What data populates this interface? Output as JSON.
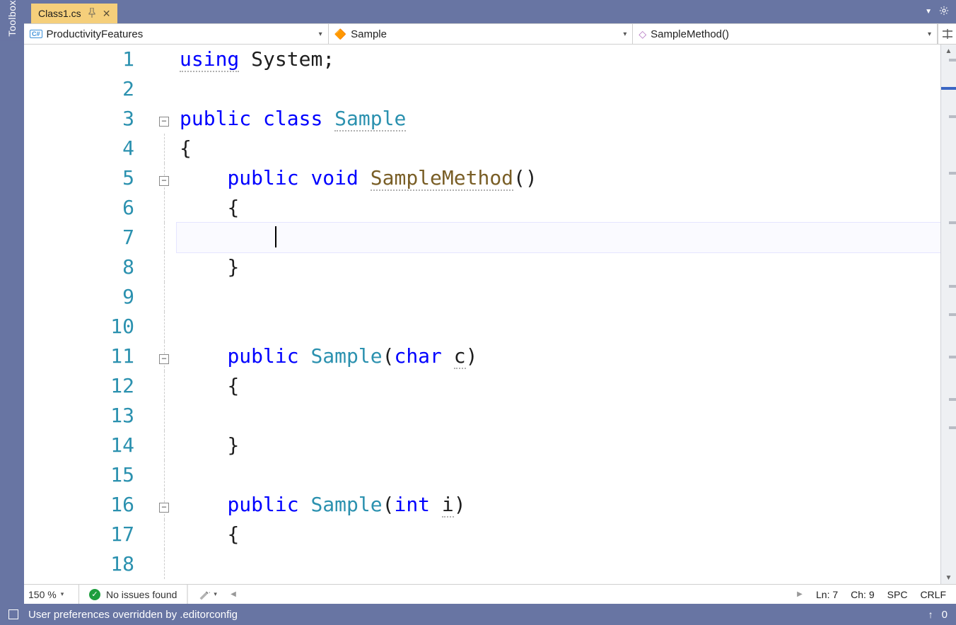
{
  "toolbox_label": "Toolbox",
  "tab": {
    "filename": "Class1.cs"
  },
  "nav": {
    "namespace": "ProductivityFeatures",
    "class": "Sample",
    "member": "SampleMethod()"
  },
  "code": {
    "line_numbers": [
      "1",
      "2",
      "3",
      "4",
      "5",
      "6",
      "7",
      "8",
      "9",
      "10",
      "11",
      "12",
      "13",
      "14",
      "15",
      "16",
      "17",
      "18"
    ],
    "folds": {
      "3": true,
      "5": true,
      "11": true,
      "16": true
    },
    "l1": {
      "using": "using",
      "system": "System",
      "semi": ";"
    },
    "l3": {
      "public": "public",
      "class_kw": "class",
      "name": "Sample"
    },
    "l4": "{",
    "l5": {
      "public": "public",
      "void": "void",
      "name": "SampleMethod",
      "parens": "()"
    },
    "l6": "{",
    "l8": "}",
    "l11": {
      "public": "public",
      "name": "Sample",
      "open": "(",
      "type": "char",
      "param": "c",
      "close": ")"
    },
    "l12": "{",
    "l14": "}",
    "l16": {
      "public": "public",
      "name": "Sample",
      "open": "(",
      "type": "int",
      "param": "i",
      "close": ")"
    },
    "l17": "{"
  },
  "bottom": {
    "zoom": "150 %",
    "issues": "No issues found",
    "ln_label": "Ln:",
    "ln": "7",
    "ch_label": "Ch:",
    "ch": "9",
    "spc": "SPC",
    "crlf": "CRLF"
  },
  "status": {
    "message": "User preferences overridden by .editorconfig",
    "zero": "0"
  }
}
